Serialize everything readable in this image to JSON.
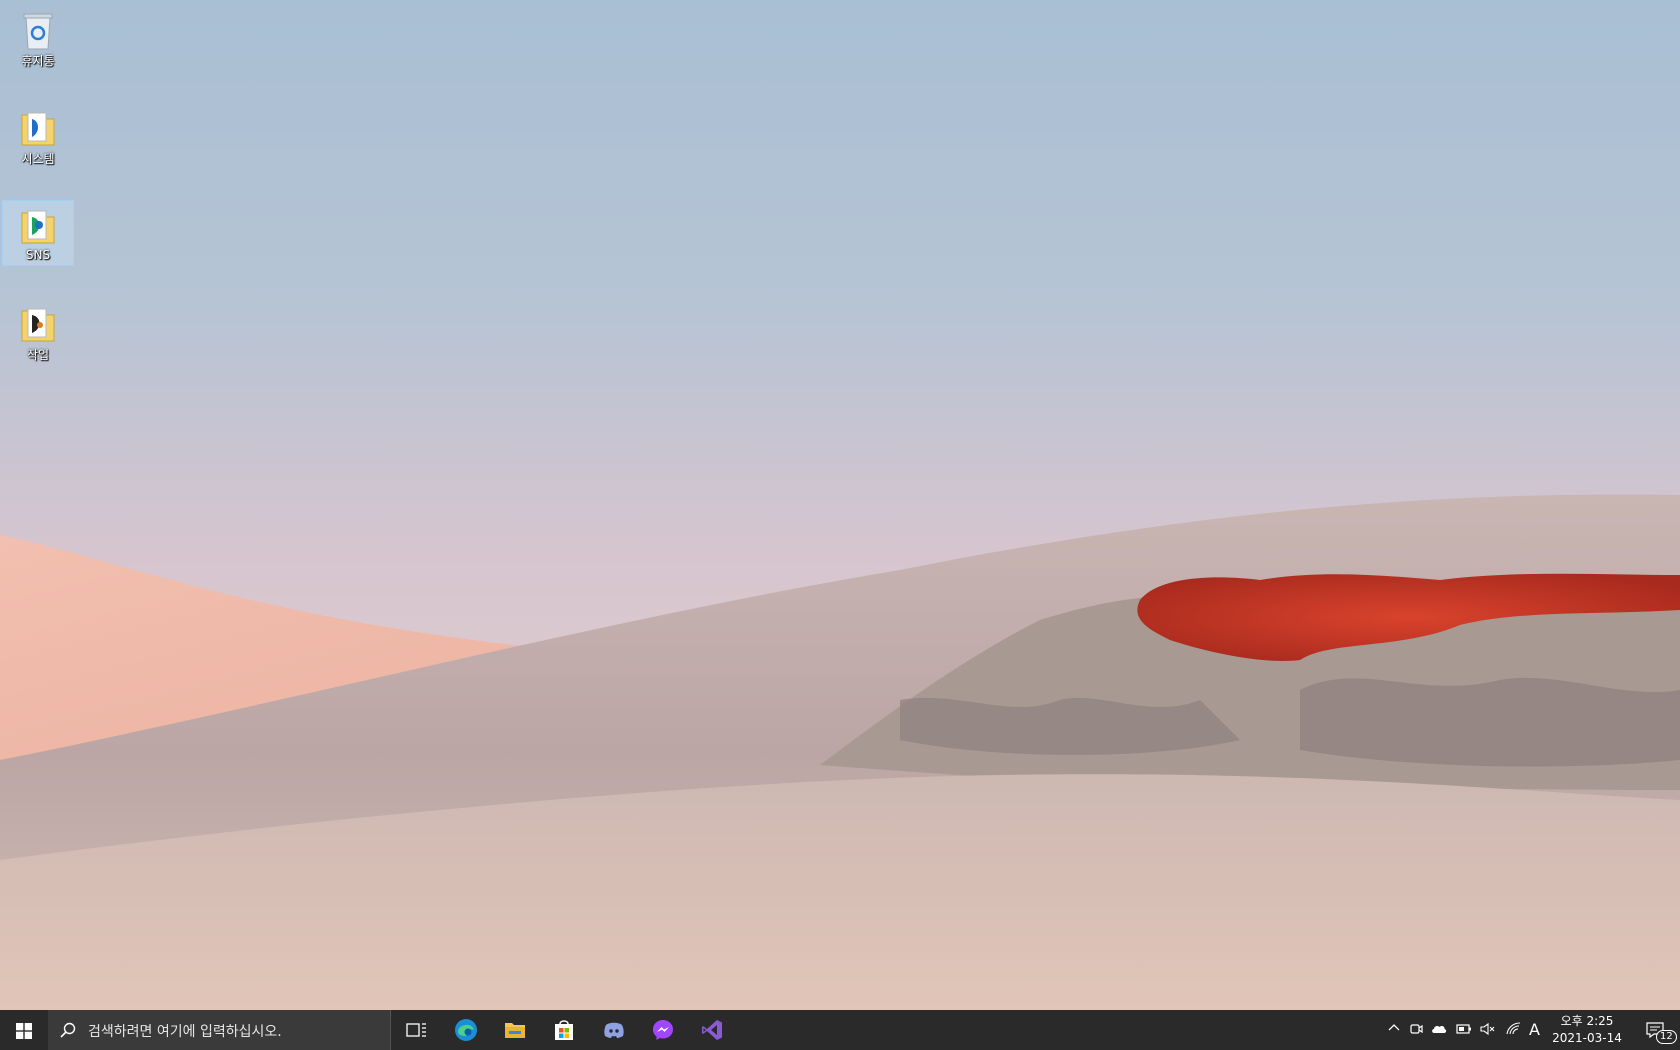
{
  "desktop": {
    "icons": [
      {
        "label": "휴지통",
        "icon": "recycle-bin-icon"
      },
      {
        "label": "시스템",
        "icon": "folder-icon"
      },
      {
        "label": "SNS",
        "icon": "folder-icon",
        "selected": true
      },
      {
        "label": "작업",
        "icon": "folder-icon"
      }
    ]
  },
  "taskbar": {
    "search_placeholder": "검색하려면 여기에 입력하십시오.",
    "pinned_apps": [
      "task-view-icon",
      "edge-icon",
      "file-explorer-icon",
      "store-icon",
      "discord-icon",
      "messenger-icon",
      "visual-studio-icon"
    ],
    "tray": {
      "ime_label": "A",
      "time": "오후 2:25",
      "date": "2021-03-14",
      "notification_count": "12"
    }
  }
}
